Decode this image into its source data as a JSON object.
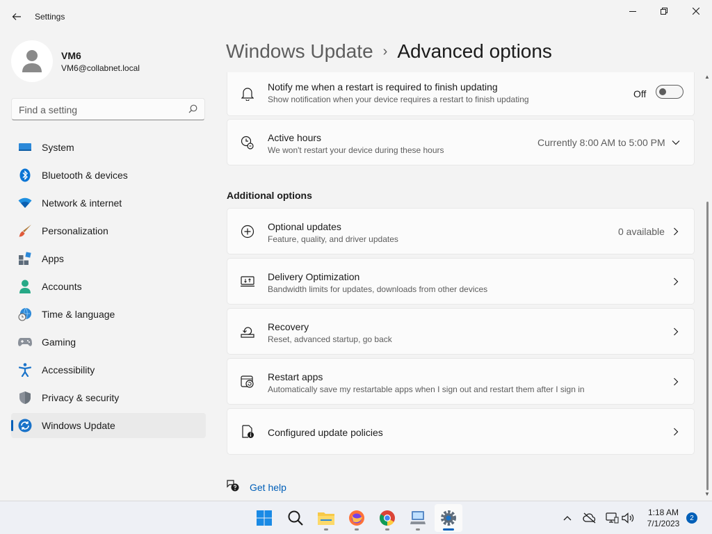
{
  "window": {
    "title": "Settings"
  },
  "profile": {
    "name": "VM6",
    "email": "VM6@collabnet.local"
  },
  "search": {
    "placeholder": "Find a setting"
  },
  "sidebar": {
    "items": [
      {
        "label": "System",
        "icon": "system-icon"
      },
      {
        "label": "Bluetooth & devices",
        "icon": "bluetooth-icon"
      },
      {
        "label": "Network & internet",
        "icon": "wifi-icon"
      },
      {
        "label": "Personalization",
        "icon": "brush-icon"
      },
      {
        "label": "Apps",
        "icon": "apps-icon"
      },
      {
        "label": "Accounts",
        "icon": "person-icon"
      },
      {
        "label": "Time & language",
        "icon": "globe-clock-icon"
      },
      {
        "label": "Gaming",
        "icon": "gamepad-icon"
      },
      {
        "label": "Accessibility",
        "icon": "accessibility-icon"
      },
      {
        "label": "Privacy & security",
        "icon": "shield-icon"
      },
      {
        "label": "Windows Update",
        "icon": "update-icon",
        "active": true
      }
    ]
  },
  "breadcrumb": {
    "parent": "Windows Update",
    "separator": "›",
    "current": "Advanced options"
  },
  "settings": {
    "notify": {
      "title": "Notify me when a restart is required to finish updating",
      "desc": "Show notification when your device requires a restart to finish updating",
      "state_label": "Off",
      "on": false
    },
    "active_hours": {
      "title": "Active hours",
      "desc": "We won't restart your device during these hours",
      "value": "Currently 8:00 AM to 5:00 PM"
    }
  },
  "additional": {
    "heading": "Additional options",
    "optional_updates": {
      "title": "Optional updates",
      "desc": "Feature, quality, and driver updates",
      "value": "0 available"
    },
    "delivery": {
      "title": "Delivery Optimization",
      "desc": "Bandwidth limits for updates, downloads from other devices"
    },
    "recovery": {
      "title": "Recovery",
      "desc": "Reset, advanced startup, go back"
    },
    "restart_apps": {
      "title": "Restart apps",
      "desc": "Automatically save my restartable apps when I sign out and restart them after I sign in"
    },
    "policies": {
      "title": "Configured update policies"
    }
  },
  "help": {
    "label": "Get help"
  },
  "taskbar": {
    "apps": [
      "start",
      "search",
      "file-explorer",
      "firefox",
      "chrome",
      "remote-desktop",
      "settings"
    ],
    "clock_time": "1:18 AM",
    "clock_date": "7/1/2023",
    "notification_count": "2"
  },
  "colors": {
    "accent": "#005fb8",
    "background": "#f3f3f3",
    "card": "#fbfbfb"
  }
}
